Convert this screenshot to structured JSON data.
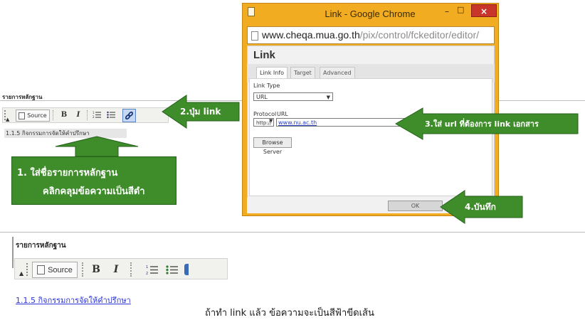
{
  "dialog": {
    "window_title": "Link - Google Chrome",
    "close_glyph": "×",
    "min_glyph": "–",
    "max_glyph": "□",
    "url_host": "www.cheqa.mua.go.th",
    "url_path": "/pix/control/fckeditor/editor/",
    "heading": "Link",
    "tabs": [
      "Link Info",
      "Target",
      "Advanced"
    ],
    "link_type_label": "Link Type",
    "link_type_value": "URL",
    "protocol_label": "Protocol",
    "protocol_value": "http://",
    "url_label": "URL",
    "url_value": "www.nu.ac.th",
    "browse_button": "Browse Server",
    "ok_button": "OK"
  },
  "top_editor": {
    "title": "รายการหลักฐาน",
    "source_label": "Source",
    "bold_glyph": "B",
    "italic_glyph": "I",
    "content": "1.1.5 กิจกรรมการจัดให้คำปรึกษา"
  },
  "bottom_editor": {
    "title": "รายการหลักฐาน",
    "source_label": "Source",
    "bold_glyph": "B",
    "italic_glyph": "I",
    "link_text": "1.1.5 กิจกรรมการจัดให้คำปรึกษา"
  },
  "callouts": {
    "step1_line1": "1.  ใส่ชื่อรายการหลักฐาน",
    "step1_line2": "คลิกคลุมข้อความเป็นสีดำ",
    "step2": "2.ปุ่ม link",
    "step3": "3.ใส่ url ที่ต้องการ link เอกสาร",
    "step4": "4.บันทึก"
  },
  "caption": "ถ้าทำ link แล้ว ข้อความจะเป็นสีฟ้าขีดเส้น",
  "colors": {
    "callout_green": "#3f8c2b",
    "chrome_orange": "#f2ac22",
    "link_blue": "#2b35d6"
  }
}
